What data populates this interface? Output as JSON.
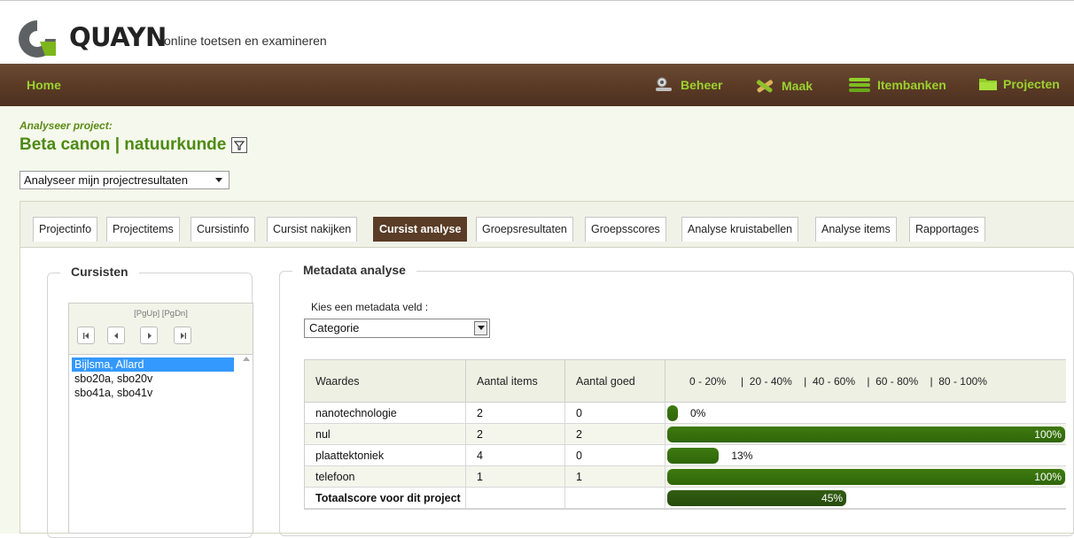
{
  "brand": {
    "name": "QUAYN",
    "tagline": "online toetsen en examineren"
  },
  "nav": {
    "home": "Home",
    "items": [
      {
        "label": "Beheer",
        "icon": "wrench-icon"
      },
      {
        "label": "Maak",
        "icon": "tools-icon"
      },
      {
        "label": "Itembanken",
        "icon": "database-icon"
      },
      {
        "label": "Projecten",
        "icon": "folder-icon"
      }
    ]
  },
  "project": {
    "label": "Analyseer project:",
    "title": "Beta canon | natuurkunde",
    "mode_select": "Analyseer mijn projectresultaten"
  },
  "tabs": [
    {
      "label": "Projectinfo"
    },
    {
      "label": "Projectitems"
    },
    {
      "label": "Cursistinfo"
    },
    {
      "label": "Cursist nakijken"
    },
    {
      "label": "Cursist analyse",
      "active": true
    },
    {
      "label": "Groepsresultaten"
    },
    {
      "label": "Groepsscores"
    },
    {
      "label": "Analyse kruistabellen"
    },
    {
      "label": "Analyse items"
    },
    {
      "label": "Rapportages"
    }
  ],
  "students": {
    "legend": "Cursisten",
    "pager_label": "[PgUp] [PgDn]",
    "list": [
      "Bijlsma, Allard",
      "sbo20a, sbo20v",
      "sbo41a, sbo41v"
    ],
    "selected_index": 0
  },
  "metadata": {
    "legend": "Metadata analyse",
    "field_label": "Kies een metadata veld :",
    "field_value": "Categorie",
    "columns": {
      "waardes": "Waardes",
      "aantal_items": "Aantal items",
      "aantal_goed": "Aantal goed",
      "scale": "0 - 20%     |  20 - 40%    |  40 - 60%    |  60 - 80%    |  80 - 100%"
    },
    "rows": [
      {
        "name": "nanotechnologie",
        "items": "2",
        "goed": "0",
        "percent": 0,
        "percent_label": "0%"
      },
      {
        "name": "nul",
        "items": "2",
        "goed": "2",
        "percent": 100,
        "percent_label": "100%"
      },
      {
        "name": "plaattektoniek",
        "items": "4",
        "goed": "0",
        "percent": 13,
        "percent_label": "13%"
      },
      {
        "name": "telefoon",
        "items": "1",
        "goed": "1",
        "percent": 100,
        "percent_label": "100%"
      }
    ],
    "total": {
      "name": "Totaalscore voor dit project",
      "percent": 45,
      "percent_label": "45%"
    }
  },
  "colors": {
    "accent": "#9bd12f",
    "nav_bg": "#5a3a26",
    "title_green": "#4d8a12",
    "bar_green": "#3e7a10"
  }
}
